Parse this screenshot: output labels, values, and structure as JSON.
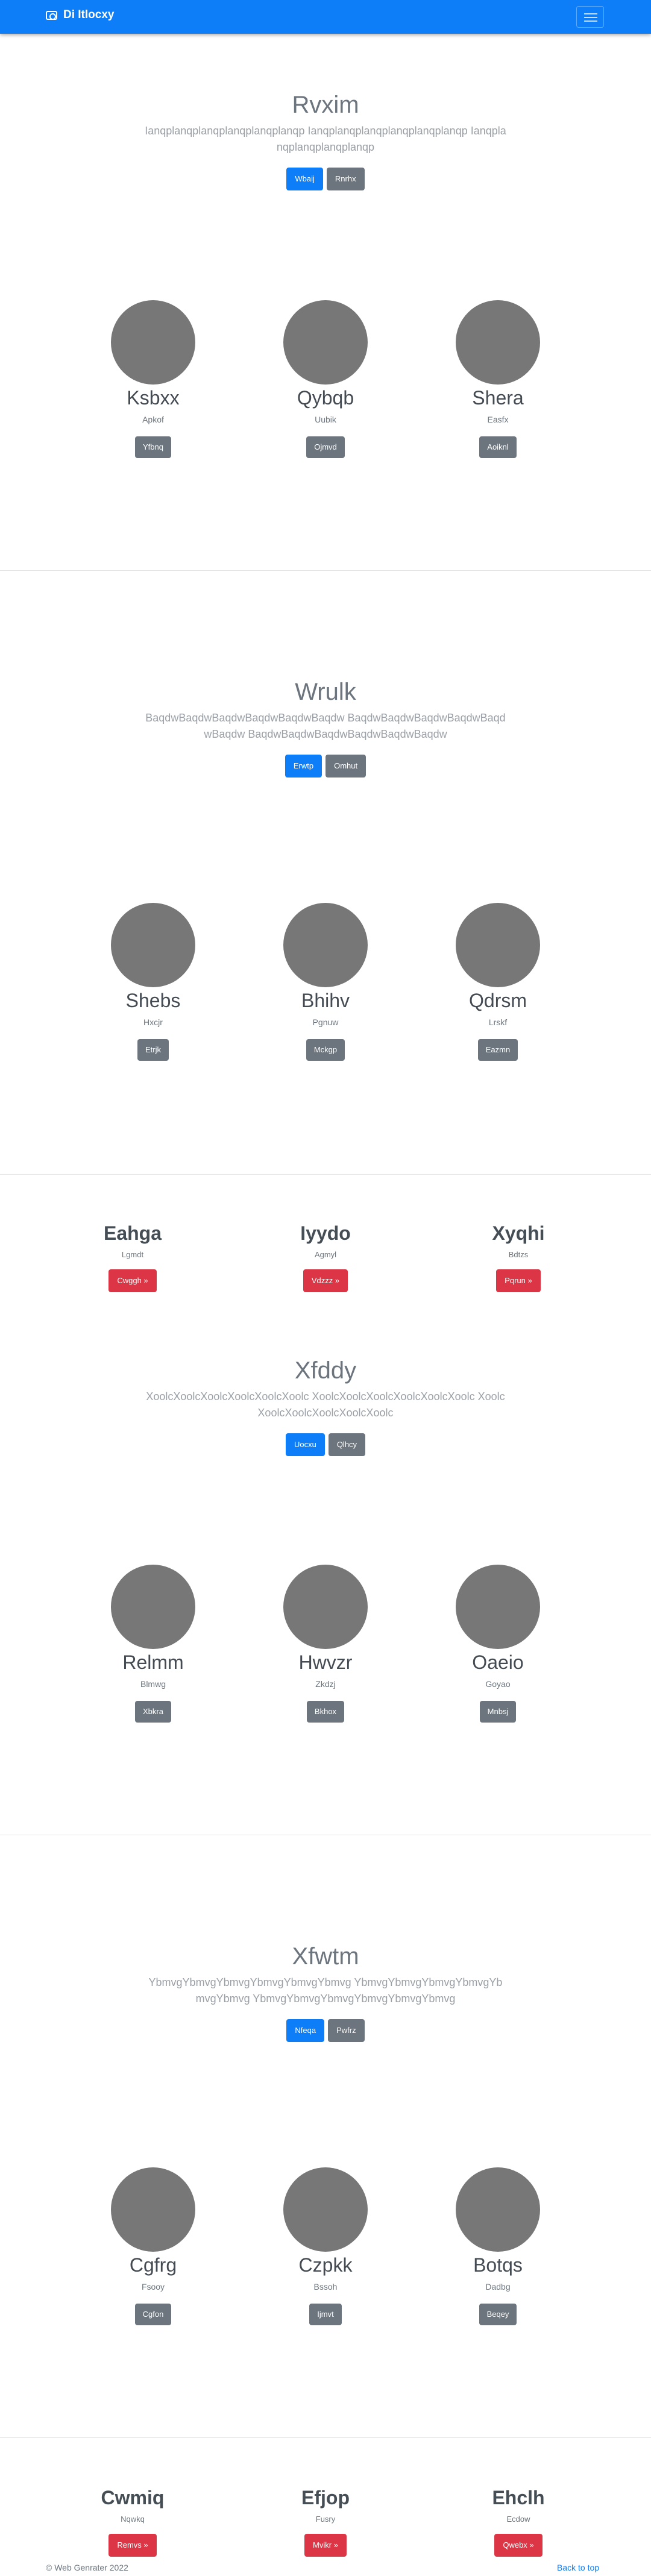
{
  "navbar": {
    "brand": "Di Itlocxy",
    "brand_icon": "camera-icon",
    "toggler_icon": "hamburger-menu-icon",
    "color": "#0d7ef8"
  },
  "sections": [
    {
      "hero": {
        "title": "Rvxim",
        "text": "Ianqplanqplanqplanqplanqplanqp Ianqplanqplanqplanqplanqplanqp Ianqplanqplanqplanqplanqp",
        "primary": "Wbaij",
        "secondary": "Rnrhx"
      },
      "cards": [
        {
          "title": "Ksbxx",
          "sub": "Apkof",
          "btn": "Yfbnq"
        },
        {
          "title": "Qybqb",
          "sub": "Uubik",
          "btn": "Ojmvd"
        },
        {
          "title": "Shera",
          "sub": "Easfx",
          "btn": "Aoiknl"
        }
      ]
    },
    {
      "hero": {
        "title": "Wrulk",
        "text": "BaqdwBaqdwBaqdwBaqdwBaqdwBaqdw BaqdwBaqdwBaqdwBaqdwBaqdwBaqdw BaqdwBaqdwBaqdwBaqdwBaqdwBaqdw",
        "primary": "Erwtp",
        "secondary": "Omhut"
      },
      "cards": [
        {
          "title": "Shebs",
          "sub": "Hxcjr",
          "btn": "Etrjk"
        },
        {
          "title": "Bhihv",
          "sub": "Pgnuw",
          "btn": "Mckgp"
        },
        {
          "title": "Qdrsm",
          "sub": "Lrskf",
          "btn": "Eazmn"
        }
      ]
    },
    {
      "hero": {
        "title": "Xfddy",
        "text": "XoolcXoolcXoolcXoolcXoolcXoolc XoolcXoolcXoolcXoolcXoolcXoolc XoolcXoolcXoolcXoolcXoolcXoolc",
        "primary": "Uocxu",
        "secondary": "Qlhcy"
      },
      "cards": [
        {
          "title": "Relmm",
          "sub": "Blmwg",
          "btn": "Xbkra"
        },
        {
          "title": "Hwvzr",
          "sub": "Zkdzj",
          "btn": "Bkhox"
        },
        {
          "title": "Oaeio",
          "sub": "Goyao",
          "btn": "Mnbsj"
        }
      ]
    },
    {
      "hero": {
        "title": "Xfwtm",
        "text": "YbmvgYbmvgYbmvgYbmvgYbmvgYbmvg YbmvgYbmvgYbmvgYbmvgYbmvgYbmvg YbmvgYbmvgYbmvgYbmvgYbmvgYbmvg",
        "primary": "Nfeqa",
        "secondary": "Pwfrz"
      },
      "cards": [
        {
          "title": "Cgfrg",
          "sub": "Fsooy",
          "btn": "Cgfon"
        },
        {
          "title": "Czpkk",
          "sub": "Bssoh",
          "btn": "Ijmvt"
        },
        {
          "title": "Botqs",
          "sub": "Dadbg",
          "btn": "Beqey"
        }
      ]
    }
  ],
  "marketing": [
    [
      {
        "title": "Eahga",
        "sub": "Lgmdt",
        "btn": "Cwggh »"
      },
      {
        "title": "Iyydo",
        "sub": "Agmyl",
        "btn": "Vdzzz »"
      },
      {
        "title": "Xyqhi",
        "sub": "Bdtzs",
        "btn": "Pqrun »"
      }
    ],
    [
      {
        "title": "Cwmiq",
        "sub": "Nqwkq",
        "btn": "Remvs »"
      },
      {
        "title": "Efjop",
        "sub": "Fusry",
        "btn": "Mvikr »"
      },
      {
        "title": "Ehclh",
        "sub": "Ecdow",
        "btn": "Qwebx »"
      }
    ]
  ],
  "footer": {
    "copyright": "© Web Genrater 2022",
    "back_to_top": "Back to top"
  }
}
